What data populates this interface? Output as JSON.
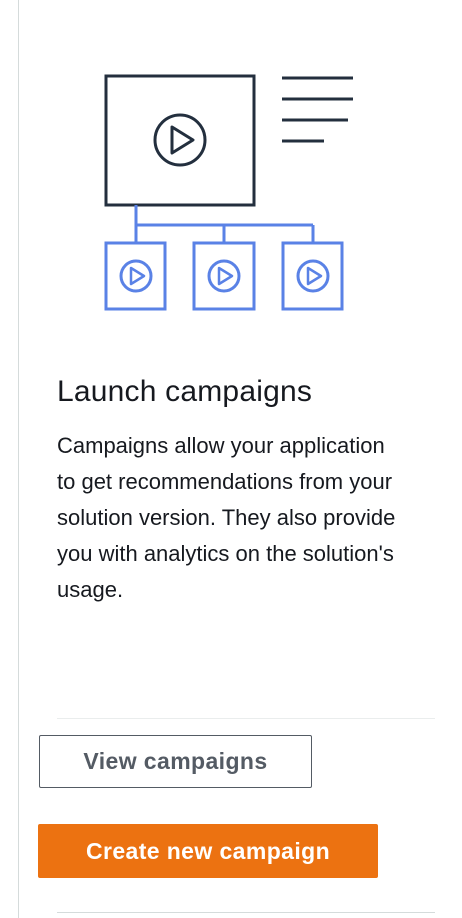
{
  "card": {
    "illustration_icon": "campaign-video-hierarchy-icon",
    "title": "Launch campaigns",
    "description": "Campaigns allow your application to get recommendations from your solution version. They also provide you with analytics on the solution's usage.",
    "buttons": {
      "secondary_label": "View campaigns",
      "primary_label": "Create new campaign"
    }
  },
  "colors": {
    "primary_button": "#ec7211",
    "secondary_button_text": "#545b64",
    "illustration_dark": "#232f3e",
    "illustration_accent": "#5a82e6",
    "text": "#16191f"
  }
}
